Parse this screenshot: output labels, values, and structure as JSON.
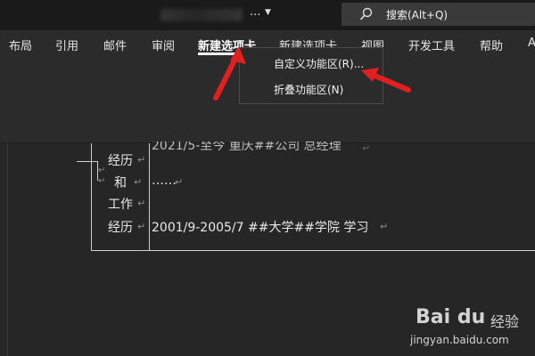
{
  "titlebar": {
    "ellipsis": "...",
    "caret": "▼",
    "search_label": "搜索(Alt+Q)"
  },
  "tabs": [
    {
      "label": "布局"
    },
    {
      "label": "引用"
    },
    {
      "label": "邮件"
    },
    {
      "label": "审阅"
    },
    {
      "label": "新建选项卡",
      "active": true
    },
    {
      "label": "新建选项卡"
    },
    {
      "label": "视图"
    },
    {
      "label": "开发工具"
    },
    {
      "label": "帮助"
    },
    {
      "label": "A"
    }
  ],
  "menu": {
    "items": [
      {
        "label": "自定义功能区(R)..."
      },
      {
        "label": "折叠功能区(N)"
      }
    ]
  },
  "document": {
    "rows": [
      {
        "label": "经历",
        "text": "2021/5-至今      重庆##公司  总经理"
      },
      {
        "label": "和",
        "text": "……"
      },
      {
        "label": "工作",
        "text": ""
      },
      {
        "label": "经历",
        "text": "2001/9-2005/7      ##大学##学院  学习"
      }
    ],
    "para_mark": "↵"
  },
  "watermark": {
    "brand": "Bai du",
    "brand_cn": "经验",
    "url": "jingyan.baidu.com"
  },
  "colors": {
    "annotation_arrow": "#e02020",
    "ribbon_bg": "#2b2b2b",
    "titlebar_bg": "#1a1a1a",
    "doc_bg": "#262626"
  }
}
